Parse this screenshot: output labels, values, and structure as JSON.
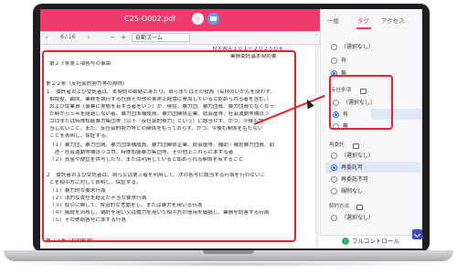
{
  "window": {
    "file_name": "C25-O002.pdf",
    "fav_icon": "star-icon",
    "chat_icon": "chat-icon"
  },
  "toolbar": {
    "page_current": "6",
    "page_total": "/ 16",
    "zoom_label": "自動ズーム",
    "prev_label": "‹",
    "next_label": "›",
    "zoom_out_label": "−",
    "zoom_in_label": "+"
  },
  "document": {
    "header_right_1": "ＮＸＷＡ１０１－２０２５０６",
    "header_right_2": "業務委託基本契約書",
    "lines": [
      "第２３条第１項各号の事由",
      "第２２条（反社会的勢力等の排除）",
      "１　委託者および受託者は、本契約の締結にあたり、自らまたはその役員（名称のいかんを問わず、",
      "相談役、顧問、業務を執行する社員その他の事実上経営に参加していると認められる者を含む。）",
      "および従業員（事業に実態を有する者をいう）が、現在、暴力団、暴力団員、暴力団員でなくなっ",
      "た時から５年を経過しない者、暴力団準構成員、暴力団関係企業、総会屋等、社会運動等標ぼう",
      "ゴロまたは特殊知能暴力集団等（以下「反社会的勢力」という）に該当せず、かつ、今後も該",
      "当しないこと、また、反社会的勢力等との関係をもっておらず、かつ、今後も関係をもたない",
      "ことを表明し、保証する。",
      "（１）暴力団、暴力団員、暴力団準構成員、暴力団関係企業、総会屋等、補助・補佐暴力団員、前",
      "　述・社会運動等標ぼうゴロ、特殊知能暴力集団等、その他上これらに準ずる者",
      "（２）資金や便宜を供与したり、または利用していると認められる関係を有すること",
      "２　委託者および受託者は、自ら又は第三者を利用して、次の各号に該当する行為を行わないこ",
      "とを相手方に対して表明し、保証する。",
      "（１）暴力的な要求行為",
      "（２）法的な責任を超えた不当な要求行為",
      "（３）取引に関して、脅迫的な言動をし、または暴力を用いる行為",
      "（４）風説を流布し、偽計を用い又は威力を用いて相手方の信用を毀損し、業務を妨害する行為",
      "（５）その他前各号に準ずる行為",
      "第２３条（契約解除）"
    ]
  },
  "panel": {
    "tabs": [
      "一般",
      "タグ",
      "アクセス"
    ],
    "active_tab": "タグ",
    "group1": {
      "options": [
        "（選択なし）",
        "有",
        "無"
      ],
      "selected": "無"
    },
    "group2": {
      "label": "反社条項",
      "options": [
        "（選択なし）",
        "有",
        "無"
      ],
      "selected": "有"
    },
    "group3": {
      "label": "再委託",
      "options": [
        "（選択なし）",
        "再委託可",
        "再委託不可",
        "規制なし"
      ],
      "selected": "再委託可"
    },
    "group4": {
      "label": "解約方法",
      "options": [
        "（選択なし）"
      ]
    },
    "footer_label": "フルコントロール",
    "accent_color": "#ee3c6c",
    "highlight_color": "#e8212e"
  }
}
